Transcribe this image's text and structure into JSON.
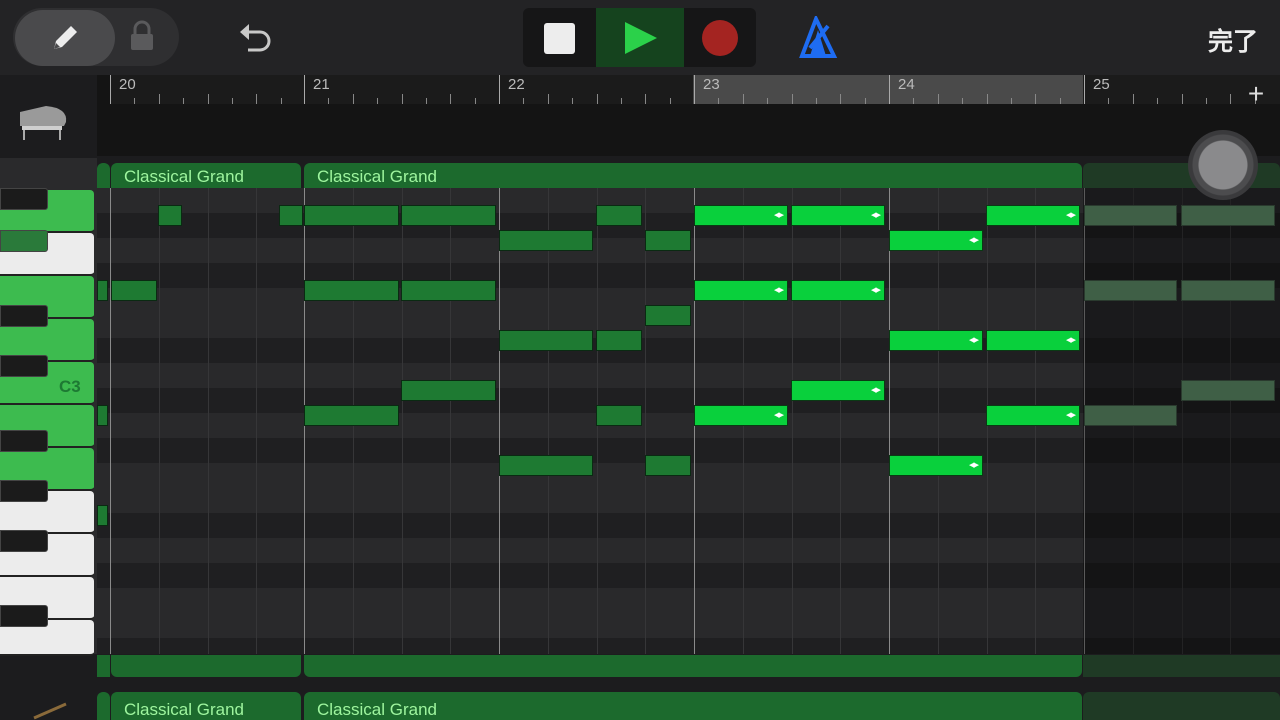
{
  "toolbar": {
    "pencil_icon": "pencil-icon",
    "lock_icon": "lock-icon",
    "undo_icon": "undo-icon",
    "stop_icon": "stop-icon",
    "play_icon": "play-icon",
    "record_icon": "record-icon",
    "metronome_icon": "metronome-icon",
    "done_label": "完了",
    "colors": {
      "play_active": "#2bd14a",
      "record": "#a42421",
      "metronome": "#1e6cf2"
    }
  },
  "ruler": {
    "bars": [
      {
        "label": "20"
      },
      {
        "label": "21"
      },
      {
        "label": "22"
      },
      {
        "label": "23"
      },
      {
        "label": "24"
      },
      {
        "label": "25"
      }
    ],
    "add_label": "+"
  },
  "regions": [
    {
      "label": "Classical Grand"
    },
    {
      "label": "Classical Grand"
    }
  ],
  "next_track": {
    "regions": [
      {
        "label": "Classical Grand"
      },
      {
        "label": "Classical Grand"
      }
    ]
  },
  "keyboard": {
    "c3_label": "C3",
    "highlight_color": "#3dbb4f"
  },
  "notes_colors": {
    "selected": "#09d03c",
    "unselected": "#1e7a32",
    "outside": "#3f5f46"
  }
}
